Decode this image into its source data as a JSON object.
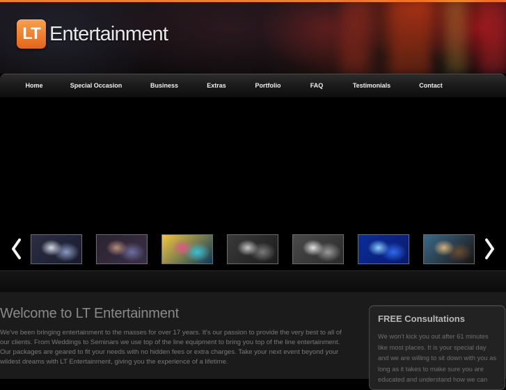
{
  "header": {
    "logo_badge": "LT",
    "logo_text": "Entertainment"
  },
  "nav": {
    "items": [
      {
        "label": "Home"
      },
      {
        "label": "Special Occasion"
      },
      {
        "label": "Business"
      },
      {
        "label": "Extras"
      },
      {
        "label": "Portfolio"
      },
      {
        "label": "FAQ"
      },
      {
        "label": "Testimonials"
      },
      {
        "label": "Contact"
      }
    ]
  },
  "carousel": {
    "prev_icon": "chevron-left-icon",
    "next_icon": "chevron-right-icon",
    "thumbnails": [
      {
        "name": "photo-projection-screen",
        "colors": [
          "#1a1a2e",
          "#8a9ac0",
          "#d8dce8",
          "#2b2f44"
        ]
      },
      {
        "name": "photo-dance-floor-crowd",
        "colors": [
          "#3a3048",
          "#6f6ea0",
          "#b88f78",
          "#2a2330"
        ]
      },
      {
        "name": "photo-dj-booth-lights",
        "colors": [
          "#0c3a5a",
          "#38c0d8",
          "#e0568a",
          "#f2c640"
        ]
      },
      {
        "name": "photo-black-white-party",
        "colors": [
          "#1c1c1c",
          "#7a7a7a",
          "#c8c8c8",
          "#3a3a3a"
        ]
      },
      {
        "name": "photo-photo-booth-bw",
        "colors": [
          "#2a2a2a",
          "#9a9a9a",
          "#e4e4e4",
          "#4a4a4a"
        ]
      },
      {
        "name": "photo-blue-uplighting",
        "colors": [
          "#0a1a6a",
          "#2f6af0",
          "#8ad0ff",
          "#0a2d9a"
        ]
      },
      {
        "name": "photo-ballroom-uplights",
        "colors": [
          "#1a1410",
          "#6a4a30",
          "#d8b078",
          "#3a6a8a"
        ]
      }
    ]
  },
  "welcome": {
    "title": "Welcome to LT Entertainment",
    "text": "We've been bringing entertainment to the masses for over 17 years. It's our passion to provide the very best to all of our clients. From Weddings to Seminars we use top of the line equipment to bring you top of the line entertainment. Our packages are geared to fit your needs with no hidden fees or extra charges. Take your next event beyond your wildest dreams with LT Entertainment, giving you the experience of a lifetime."
  },
  "consultation": {
    "title": "FREE Consultations",
    "text": "We won't kick you out after 61 minutes like most places. It is your special day and we are willing to sit down with you as long as it takes to make sure you are educated and understand how we can"
  },
  "colors": {
    "accent": "#f07f2a",
    "nav_text": "#f0f0f0",
    "body_bg": "#000000",
    "content_bg": "#1b1b1b"
  }
}
